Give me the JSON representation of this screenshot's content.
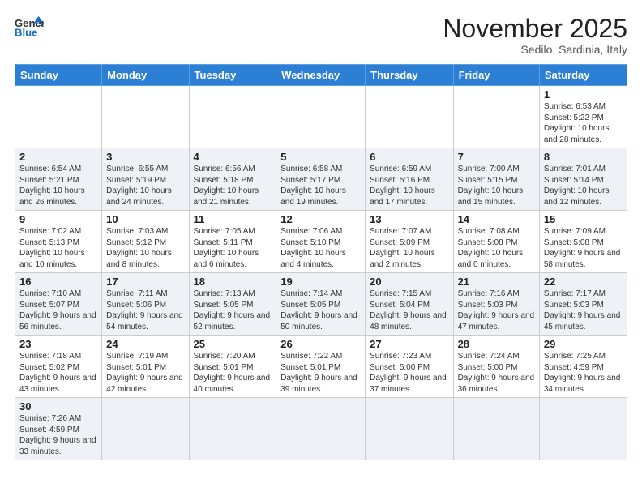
{
  "header": {
    "logo_general": "General",
    "logo_blue": "Blue",
    "month_title": "November 2025",
    "location": "Sedilo, Sardinia, Italy"
  },
  "weekdays": [
    "Sunday",
    "Monday",
    "Tuesday",
    "Wednesday",
    "Thursday",
    "Friday",
    "Saturday"
  ],
  "weeks": [
    [
      {
        "day": "",
        "info": ""
      },
      {
        "day": "",
        "info": ""
      },
      {
        "day": "",
        "info": ""
      },
      {
        "day": "",
        "info": ""
      },
      {
        "day": "",
        "info": ""
      },
      {
        "day": "",
        "info": ""
      },
      {
        "day": "1",
        "info": "Sunrise: 6:53 AM\nSunset: 5:22 PM\nDaylight: 10 hours\nand 28 minutes."
      }
    ],
    [
      {
        "day": "2",
        "info": "Sunrise: 6:54 AM\nSunset: 5:21 PM\nDaylight: 10 hours\nand 26 minutes."
      },
      {
        "day": "3",
        "info": "Sunrise: 6:55 AM\nSunset: 5:19 PM\nDaylight: 10 hours\nand 24 minutes."
      },
      {
        "day": "4",
        "info": "Sunrise: 6:56 AM\nSunset: 5:18 PM\nDaylight: 10 hours\nand 21 minutes."
      },
      {
        "day": "5",
        "info": "Sunrise: 6:58 AM\nSunset: 5:17 PM\nDaylight: 10 hours\nand 19 minutes."
      },
      {
        "day": "6",
        "info": "Sunrise: 6:59 AM\nSunset: 5:16 PM\nDaylight: 10 hours\nand 17 minutes."
      },
      {
        "day": "7",
        "info": "Sunrise: 7:00 AM\nSunset: 5:15 PM\nDaylight: 10 hours\nand 15 minutes."
      },
      {
        "day": "8",
        "info": "Sunrise: 7:01 AM\nSunset: 5:14 PM\nDaylight: 10 hours\nand 12 minutes."
      }
    ],
    [
      {
        "day": "9",
        "info": "Sunrise: 7:02 AM\nSunset: 5:13 PM\nDaylight: 10 hours\nand 10 minutes."
      },
      {
        "day": "10",
        "info": "Sunrise: 7:03 AM\nSunset: 5:12 PM\nDaylight: 10 hours\nand 8 minutes."
      },
      {
        "day": "11",
        "info": "Sunrise: 7:05 AM\nSunset: 5:11 PM\nDaylight: 10 hours\nand 6 minutes."
      },
      {
        "day": "12",
        "info": "Sunrise: 7:06 AM\nSunset: 5:10 PM\nDaylight: 10 hours\nand 4 minutes."
      },
      {
        "day": "13",
        "info": "Sunrise: 7:07 AM\nSunset: 5:09 PM\nDaylight: 10 hours\nand 2 minutes."
      },
      {
        "day": "14",
        "info": "Sunrise: 7:08 AM\nSunset: 5:08 PM\nDaylight: 10 hours\nand 0 minutes."
      },
      {
        "day": "15",
        "info": "Sunrise: 7:09 AM\nSunset: 5:08 PM\nDaylight: 9 hours\nand 58 minutes."
      }
    ],
    [
      {
        "day": "16",
        "info": "Sunrise: 7:10 AM\nSunset: 5:07 PM\nDaylight: 9 hours\nand 56 minutes."
      },
      {
        "day": "17",
        "info": "Sunrise: 7:11 AM\nSunset: 5:06 PM\nDaylight: 9 hours\nand 54 minutes."
      },
      {
        "day": "18",
        "info": "Sunrise: 7:13 AM\nSunset: 5:05 PM\nDaylight: 9 hours\nand 52 minutes."
      },
      {
        "day": "19",
        "info": "Sunrise: 7:14 AM\nSunset: 5:05 PM\nDaylight: 9 hours\nand 50 minutes."
      },
      {
        "day": "20",
        "info": "Sunrise: 7:15 AM\nSunset: 5:04 PM\nDaylight: 9 hours\nand 48 minutes."
      },
      {
        "day": "21",
        "info": "Sunrise: 7:16 AM\nSunset: 5:03 PM\nDaylight: 9 hours\nand 47 minutes."
      },
      {
        "day": "22",
        "info": "Sunrise: 7:17 AM\nSunset: 5:03 PM\nDaylight: 9 hours\nand 45 minutes."
      }
    ],
    [
      {
        "day": "23",
        "info": "Sunrise: 7:18 AM\nSunset: 5:02 PM\nDaylight: 9 hours\nand 43 minutes."
      },
      {
        "day": "24",
        "info": "Sunrise: 7:19 AM\nSunset: 5:01 PM\nDaylight: 9 hours\nand 42 minutes."
      },
      {
        "day": "25",
        "info": "Sunrise: 7:20 AM\nSunset: 5:01 PM\nDaylight: 9 hours\nand 40 minutes."
      },
      {
        "day": "26",
        "info": "Sunrise: 7:22 AM\nSunset: 5:01 PM\nDaylight: 9 hours\nand 39 minutes."
      },
      {
        "day": "27",
        "info": "Sunrise: 7:23 AM\nSunset: 5:00 PM\nDaylight: 9 hours\nand 37 minutes."
      },
      {
        "day": "28",
        "info": "Sunrise: 7:24 AM\nSunset: 5:00 PM\nDaylight: 9 hours\nand 36 minutes."
      },
      {
        "day": "29",
        "info": "Sunrise: 7:25 AM\nSunset: 4:59 PM\nDaylight: 9 hours\nand 34 minutes."
      }
    ],
    [
      {
        "day": "30",
        "info": "Sunrise: 7:26 AM\nSunset: 4:59 PM\nDaylight: 9 hours\nand 33 minutes."
      },
      {
        "day": "",
        "info": ""
      },
      {
        "day": "",
        "info": ""
      },
      {
        "day": "",
        "info": ""
      },
      {
        "day": "",
        "info": ""
      },
      {
        "day": "",
        "info": ""
      },
      {
        "day": "",
        "info": ""
      }
    ]
  ]
}
